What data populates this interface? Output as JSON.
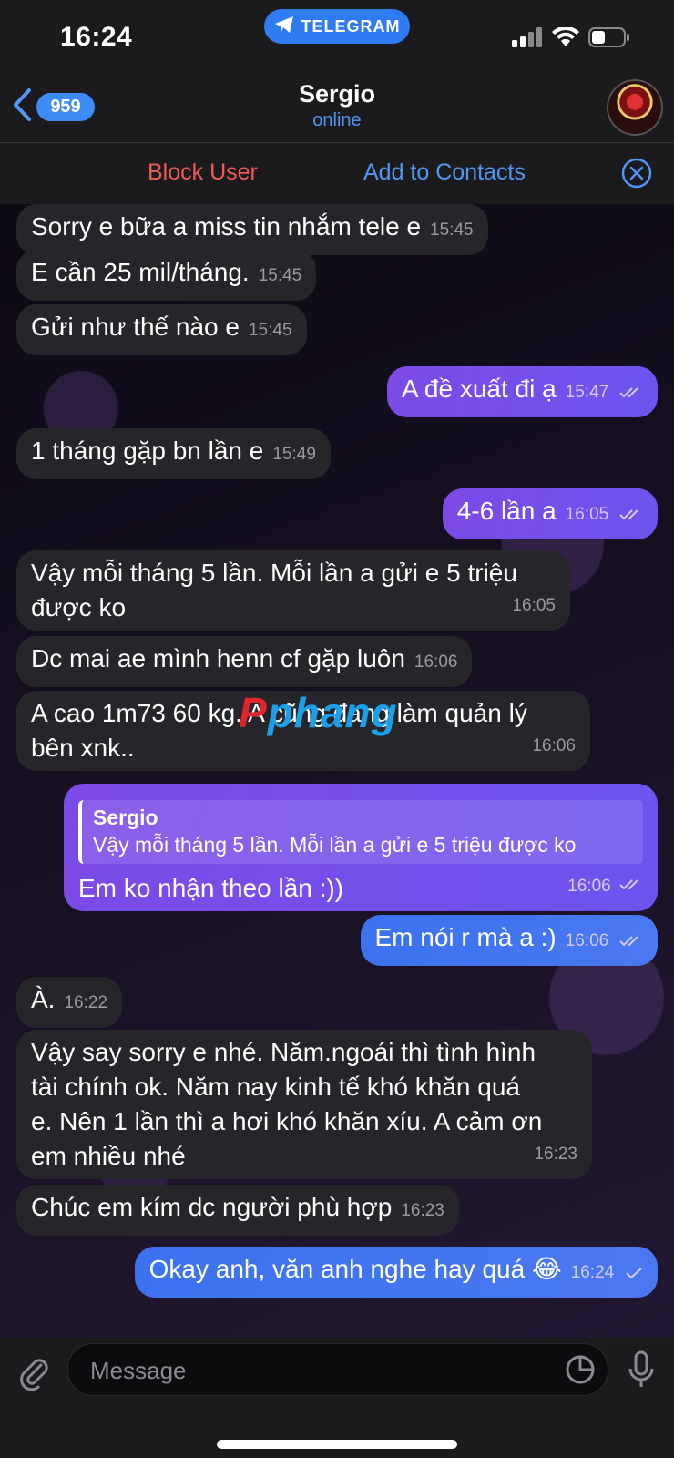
{
  "status_bar": {
    "time": "16:24",
    "app_pill": "TELEGRAM"
  },
  "header": {
    "back_count": "959",
    "title": "Sergio",
    "subtitle": "online"
  },
  "action_bar": {
    "block_label": "Block User",
    "add_label": "Add to Contacts"
  },
  "watermark": {
    "p": "P",
    "rest": "phang"
  },
  "messages": [
    {
      "dir": "in",
      "text": "Sorry e bữa a miss tin nhắm tele e",
      "time": "15:45"
    },
    {
      "dir": "in",
      "text": "E cần 25 mil/tháng.",
      "time": "15:45"
    },
    {
      "dir": "in",
      "text": "Gửi như thế nào e",
      "time": "15:45"
    },
    {
      "dir": "out",
      "text": "A đề xuất đi ạ",
      "time": "15:47"
    },
    {
      "dir": "in",
      "text": "1 tháng gặp bn lần e",
      "time": "15:49"
    },
    {
      "dir": "out",
      "text": "4-6 lần a",
      "time": "16:05"
    },
    {
      "dir": "in",
      "text_lines": [
        "Vậy mỗi tháng 5 lần. Mỗi lần a gửi e 5 triệu",
        "được ko"
      ],
      "time": "16:05"
    },
    {
      "dir": "in",
      "text": "Dc mai ae mình henn cf gặp luôn",
      "time": "16:06"
    },
    {
      "dir": "in",
      "text_lines": [
        "A cao 1m73 60 kg. A cũng đang làm quản lý",
        "bên xnk.."
      ],
      "time": "16:06"
    },
    {
      "dir": "out",
      "reply_name": "Sergio",
      "reply_text": "Vậy mỗi tháng 5 lần. Mỗi lần a gửi e 5 triệu được ko",
      "text": "Em ko nhận theo lần :))",
      "time": "16:06"
    },
    {
      "dir": "out",
      "text": "Em nói r mà a :)",
      "time": "16:06"
    },
    {
      "dir": "in",
      "text": "À.",
      "time": "16:22"
    },
    {
      "dir": "in",
      "text_lines": [
        "Vậy say sorry e nhé. Năm.ngoái thì tình hình",
        "tài chính ok. Năm nay kinh tế khó khăn quá",
        "e. Nên 1 lần thì a hơi khó khăn xíu. A cảm ơn",
        "em nhiều nhé"
      ],
      "time": "16:23"
    },
    {
      "dir": "in",
      "text": "Chúc em kím dc người phù hợp",
      "time": "16:23"
    },
    {
      "dir": "out",
      "text": "Okay anh, văn anh nghe hay quá 😂",
      "time": "16:24"
    }
  ],
  "composer": {
    "placeholder": "Message"
  },
  "icons": {
    "back": "chevron-left-icon",
    "telegram": "paper-plane-icon",
    "close": "close-circle-icon",
    "attach": "paperclip-icon",
    "sticker": "sticker-icon",
    "mic": "microphone-icon"
  },
  "colors": {
    "accent": "#4f96f5",
    "danger": "#ef5a55",
    "outgoing_bubble": "#7c4ae6",
    "incoming_bubble": "#262529"
  }
}
